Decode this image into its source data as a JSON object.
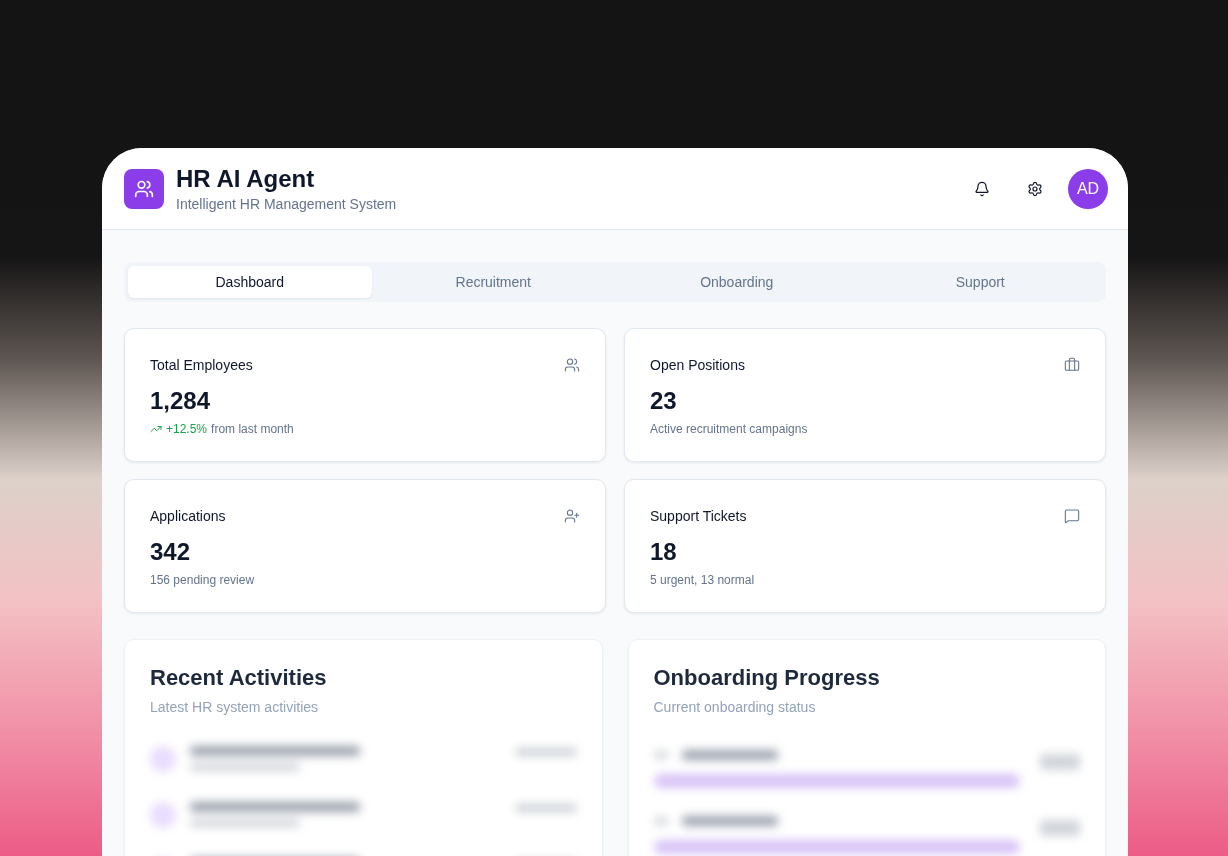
{
  "header": {
    "title": "HR AI Agent",
    "subtitle": "Intelligent HR Management System",
    "avatar_initials": "AD"
  },
  "tabs": [
    {
      "label": "Dashboard",
      "selected": true
    },
    {
      "label": "Recruitment",
      "selected": false
    },
    {
      "label": "Onboarding",
      "selected": false
    },
    {
      "label": "Support",
      "selected": false
    }
  ],
  "stats": [
    {
      "title": "Total Employees",
      "value": "1,284",
      "trend": {
        "text": "+12.5%",
        "rising": true
      },
      "note": "from last month"
    },
    {
      "title": "Open Positions",
      "value": "23",
      "note": "Active recruitment campaigns"
    },
    {
      "title": "Applications",
      "value": "342",
      "note": "156 pending review"
    },
    {
      "title": "Support Tickets",
      "value": "18",
      "note": "5 urgent, 13 normal"
    }
  ],
  "panels": [
    {
      "kind": "activities",
      "title": "Recent Activities",
      "subtitle": "Latest HR system activities"
    },
    {
      "kind": "progress",
      "title": "Onboarding Progress",
      "subtitle": "Current onboarding status"
    }
  ]
}
